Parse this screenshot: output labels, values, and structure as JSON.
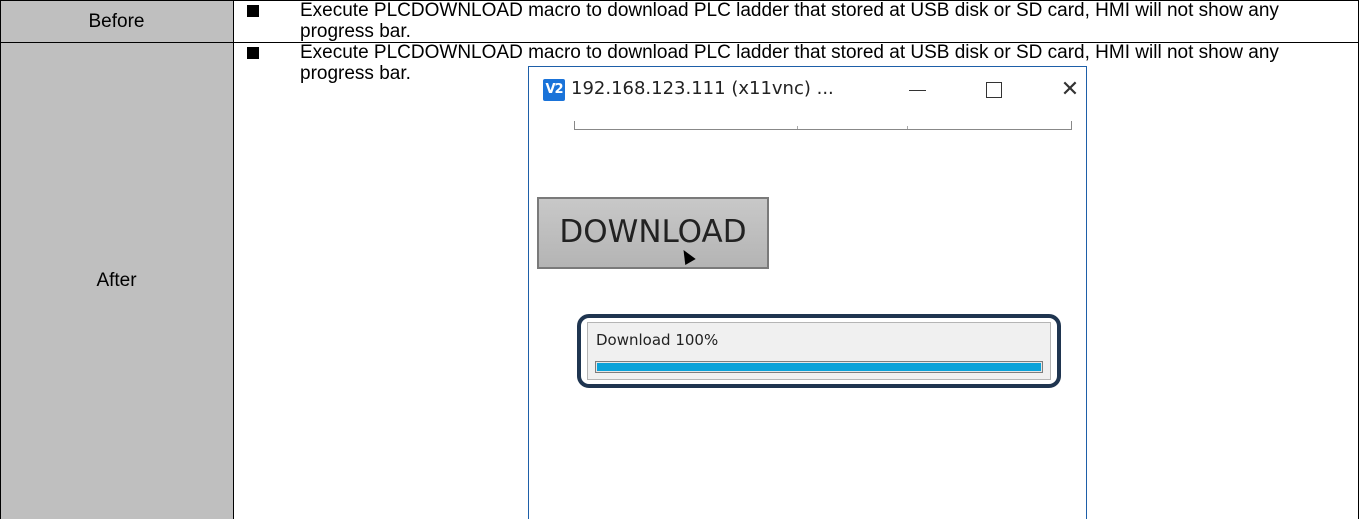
{
  "rows": [
    {
      "label": "Before",
      "bullet_text": "Execute PLCDOWNLOAD macro to download PLC ladder that stored at USB disk or SD card, HMI will not show any progress bar."
    },
    {
      "label": "After",
      "bullet_text": "Execute PLCDOWNLOAD macro to download PLC ladder that stored at USB disk or SD card, HMI will not show any progress bar."
    }
  ],
  "vnc_window": {
    "icon_text": "V2",
    "title": "192.168.123.111 (x11vnc) ...",
    "button_label": "DOWNLOAD",
    "progress_label": "Download 100%",
    "progress_fraction": 1.0,
    "progress_color": "#0aa2d9",
    "highlight_color": "#1f3550"
  },
  "colors": {
    "label_cell_bg": "#bfbfbf",
    "window_border": "#1e5fa8"
  }
}
